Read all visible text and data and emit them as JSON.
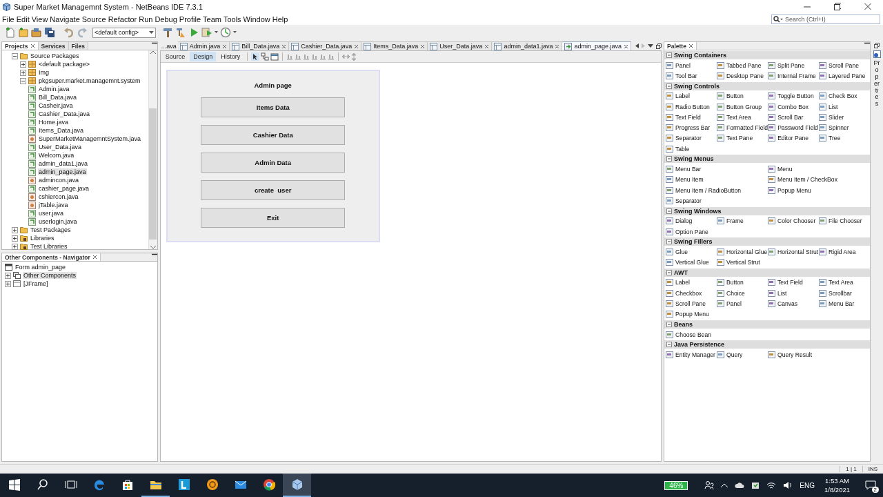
{
  "window": {
    "title": "Super Market Managemnt System - NetBeans IDE 7.3.1"
  },
  "menu": [
    "File",
    "Edit",
    "View",
    "Navigate",
    "Source",
    "Refactor",
    "Run",
    "Debug",
    "Profile",
    "Team",
    "Tools",
    "Window",
    "Help"
  ],
  "search": {
    "placeholder": "Search (Ctrl+I)"
  },
  "toolbar": {
    "config": "<default config>"
  },
  "projects_panel": {
    "tabs": [
      {
        "label": "Projects",
        "selected": true
      },
      {
        "label": "Services",
        "selected": false
      },
      {
        "label": "Files",
        "selected": false
      }
    ],
    "tree": [
      {
        "label": "Source Packages",
        "kind": "folder",
        "expanded": true,
        "selected": false,
        "children": [
          {
            "label": "<default package>",
            "kind": "package",
            "expanded": false,
            "selected": false
          },
          {
            "label": "Img",
            "kind": "package",
            "expanded": false,
            "selected": false
          },
          {
            "label": "pkgsuper.market.managemnt.system",
            "kind": "package",
            "expanded": true,
            "selected": false,
            "children": [
              {
                "label": "Admin.java",
                "kind": "form",
                "selected": false
              },
              {
                "label": "Bill_Data.java",
                "kind": "form",
                "selected": false
              },
              {
                "label": "Casheir.java",
                "kind": "form",
                "selected": false
              },
              {
                "label": "Cashier_Data.java",
                "kind": "form",
                "selected": false
              },
              {
                "label": "Home.java",
                "kind": "form",
                "selected": false
              },
              {
                "label": "Items_Data.java",
                "kind": "form",
                "selected": false
              },
              {
                "label": "SuperMarketManagemntSystem.java",
                "kind": "class",
                "selected": false
              },
              {
                "label": "User_Data.java",
                "kind": "form",
                "selected": false
              },
              {
                "label": "Welcom.java",
                "kind": "form",
                "selected": false
              },
              {
                "label": "admin_data1.java",
                "kind": "form",
                "selected": false
              },
              {
                "label": "admin_page.java",
                "kind": "form",
                "selected": true
              },
              {
                "label": "admincon.java",
                "kind": "class",
                "selected": false
              },
              {
                "label": "cashier_page.java",
                "kind": "form",
                "selected": false
              },
              {
                "label": "cshiercon.java",
                "kind": "class",
                "selected": false
              },
              {
                "label": "jTable.java",
                "kind": "class",
                "selected": false
              },
              {
                "label": "user.java",
                "kind": "form",
                "selected": false
              },
              {
                "label": "userlogin.java",
                "kind": "form",
                "selected": false
              }
            ]
          }
        ]
      },
      {
        "label": "Test Packages",
        "kind": "folder",
        "expanded": false,
        "selected": false
      },
      {
        "label": "Libraries",
        "kind": "library",
        "expanded": false,
        "selected": false
      },
      {
        "label": "Test Libraries",
        "kind": "library",
        "expanded": false,
        "selected": false
      }
    ]
  },
  "navigator": {
    "title": "Other Components - Navigator",
    "tree": [
      {
        "label": "Form admin_page",
        "kind": "root",
        "selected": false
      },
      {
        "label": "Other Components",
        "kind": "components",
        "expanded": false,
        "selected": true
      },
      {
        "label": "[JFrame]",
        "kind": "frame",
        "expanded": false,
        "selected": false
      }
    ]
  },
  "editor": {
    "hidden_tab_stub": "...ava",
    "tabs": [
      {
        "label": "Admin.java",
        "selected": false
      },
      {
        "label": "Bill_Data.java",
        "selected": false
      },
      {
        "label": "Cashier_Data.java",
        "selected": false
      },
      {
        "label": "Items_Data.java",
        "selected": false
      },
      {
        "label": "User_Data.java",
        "selected": false
      },
      {
        "label": "admin_data1.java",
        "selected": false
      },
      {
        "label": "admin_page.java",
        "selected": true
      }
    ],
    "views": [
      {
        "label": "Source",
        "selected": false
      },
      {
        "label": "Design",
        "selected": true
      },
      {
        "label": "History",
        "selected": false
      }
    ],
    "form": {
      "title": "Admin page",
      "buttons": [
        "Items Data",
        "Cashier Data",
        "Admin Data",
        "create  user",
        "Exit"
      ]
    }
  },
  "palette": {
    "title": "Palette",
    "side_tab": "Properties",
    "categories": [
      {
        "name": "Swing Containers",
        "expanded": true,
        "items": [
          "Panel",
          "Tabbed Pane",
          "Split Pane",
          "Scroll Pane",
          "Tool Bar",
          "Desktop Pane",
          "Internal Frame",
          "Layered Pane"
        ]
      },
      {
        "name": "Swing Controls",
        "expanded": true,
        "items": [
          "Label",
          "Button",
          "Toggle Button",
          "Check Box",
          "Radio Button",
          "Button Group",
          "Combo Box",
          "List",
          "Text Field",
          "Text Area",
          "Scroll Bar",
          "Slider",
          "Progress Bar",
          "Formatted Field",
          "Password Field",
          "Spinner",
          "Separator",
          "Text Pane",
          "Editor Pane",
          "Tree",
          "Table"
        ]
      },
      {
        "name": "Swing Menus",
        "expanded": true,
        "kind": "wide",
        "items": [
          "Menu Bar",
          "Menu",
          "Menu Item",
          "Menu Item / CheckBox",
          "Menu Item / RadioButton",
          "Popup Menu",
          "Separator"
        ]
      },
      {
        "name": "Swing Windows",
        "expanded": true,
        "items": [
          "Dialog",
          "Frame",
          "Color Chooser",
          "File Chooser",
          "Option Pane"
        ]
      },
      {
        "name": "Swing Fillers",
        "expanded": true,
        "items": [
          "Glue",
          "Horizontal Glue",
          "Horizontal Strut",
          "Rigid Area",
          "Vertical Glue",
          "Vertical Strut"
        ]
      },
      {
        "name": "AWT",
        "expanded": true,
        "items": [
          "Label",
          "Button",
          "Text Field",
          "Text Area",
          "Checkbox",
          "Choice",
          "List",
          "Scrollbar",
          "Scroll Pane",
          "Panel",
          "Canvas",
          "Menu Bar",
          "Popup Menu"
        ]
      },
      {
        "name": "Beans",
        "expanded": true,
        "items": [
          "Choose Bean"
        ]
      },
      {
        "name": "Java Persistence",
        "expanded": true,
        "items": [
          "Entity Manager",
          "Query",
          "Query Result"
        ]
      }
    ]
  },
  "status_bar": {
    "position": "1 | 1",
    "mode": "INS"
  },
  "taskbar": {
    "apps": [
      {
        "kind": "edge",
        "running": false,
        "active": false
      },
      {
        "kind": "store",
        "running": false,
        "active": false
      },
      {
        "kind": "explorer",
        "running": true,
        "active": false
      },
      {
        "kind": "letter",
        "running": false,
        "active": false
      },
      {
        "kind": "orange",
        "running": false,
        "active": false
      },
      {
        "kind": "mail",
        "running": false,
        "active": false
      },
      {
        "kind": "chrome",
        "running": false,
        "active": false
      },
      {
        "kind": "netbeans",
        "running": true,
        "active": true
      }
    ],
    "battery": "46%",
    "language": "ENG",
    "time": "1:53 AM",
    "date": "1/8/2021",
    "notifications": "2"
  }
}
